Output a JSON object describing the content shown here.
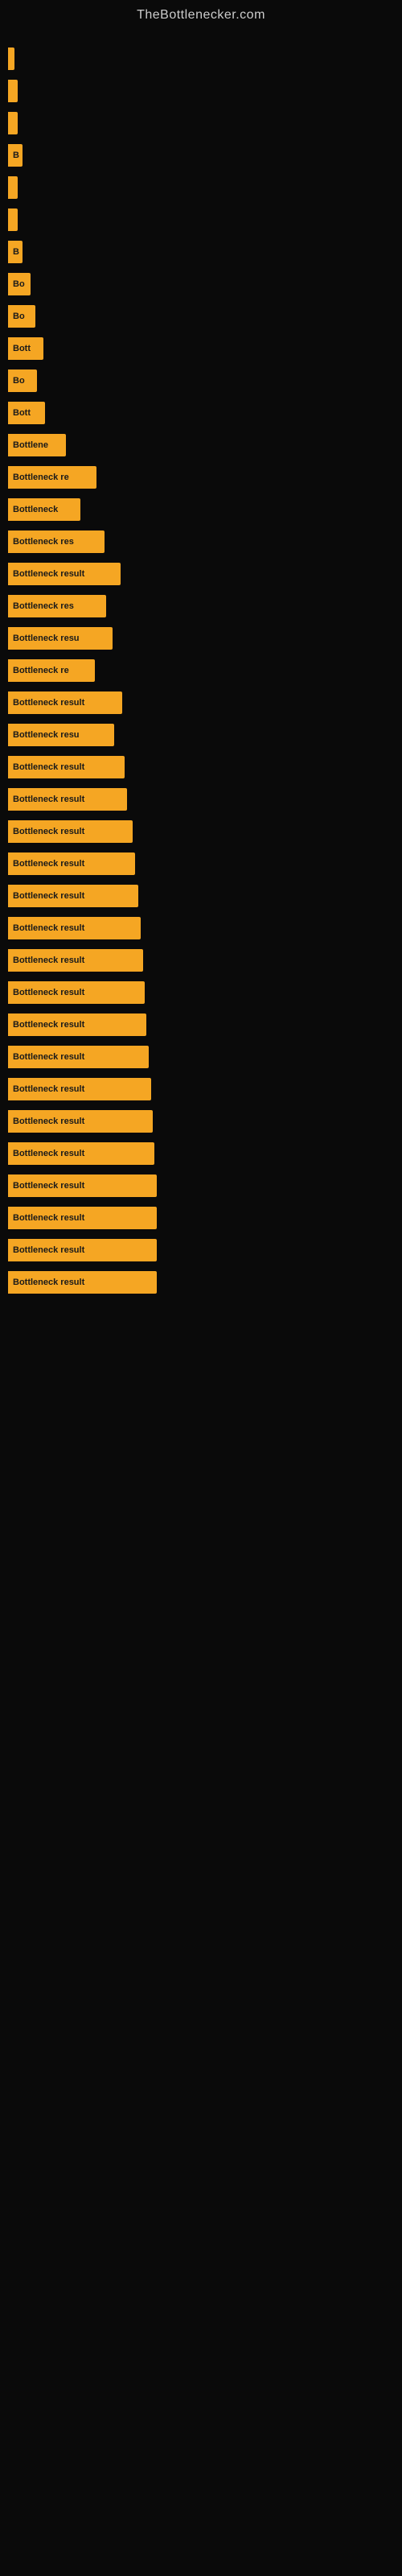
{
  "site_title": "TheBottlenecker.com",
  "bars": [
    {
      "label": "",
      "width": 8
    },
    {
      "label": "",
      "width": 12
    },
    {
      "label": "",
      "width": 12
    },
    {
      "label": "B",
      "width": 18
    },
    {
      "label": "",
      "width": 12
    },
    {
      "label": "",
      "width": 12
    },
    {
      "label": "B",
      "width": 18
    },
    {
      "label": "Bo",
      "width": 28
    },
    {
      "label": "Bo",
      "width": 34
    },
    {
      "label": "Bott",
      "width": 44
    },
    {
      "label": "Bo",
      "width": 36
    },
    {
      "label": "Bott",
      "width": 46
    },
    {
      "label": "Bottlene",
      "width": 72
    },
    {
      "label": "Bottleneck re",
      "width": 110
    },
    {
      "label": "Bottleneck",
      "width": 90
    },
    {
      "label": "Bottleneck res",
      "width": 120
    },
    {
      "label": "Bottleneck result",
      "width": 140
    },
    {
      "label": "Bottleneck res",
      "width": 122
    },
    {
      "label": "Bottleneck resu",
      "width": 130
    },
    {
      "label": "Bottleneck re",
      "width": 108
    },
    {
      "label": "Bottleneck result",
      "width": 142
    },
    {
      "label": "Bottleneck resu",
      "width": 132
    },
    {
      "label": "Bottleneck result",
      "width": 145
    },
    {
      "label": "Bottleneck result",
      "width": 148
    },
    {
      "label": "Bottleneck result",
      "width": 155
    },
    {
      "label": "Bottleneck result",
      "width": 158
    },
    {
      "label": "Bottleneck result",
      "width": 162
    },
    {
      "label": "Bottleneck result",
      "width": 165
    },
    {
      "label": "Bottleneck result",
      "width": 168
    },
    {
      "label": "Bottleneck result",
      "width": 170
    },
    {
      "label": "Bottleneck result",
      "width": 172
    },
    {
      "label": "Bottleneck result",
      "width": 175
    },
    {
      "label": "Bottleneck result",
      "width": 178
    },
    {
      "label": "Bottleneck result",
      "width": 180
    },
    {
      "label": "Bottleneck result",
      "width": 182
    },
    {
      "label": "Bottleneck result",
      "width": 185
    },
    {
      "label": "Bottleneck result",
      "width": 185
    },
    {
      "label": "Bottleneck result",
      "width": 185
    },
    {
      "label": "Bottleneck result",
      "width": 185
    }
  ]
}
